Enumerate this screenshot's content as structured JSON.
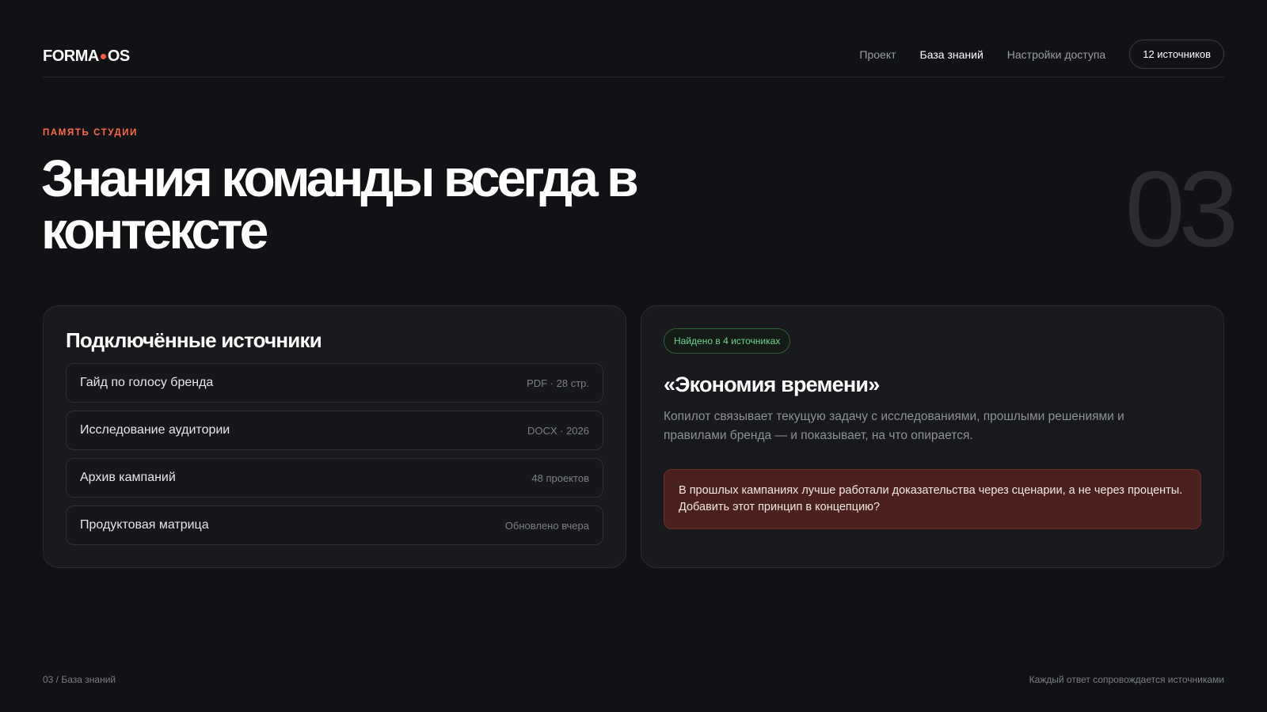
{
  "header": {
    "logo_left": "FORMA",
    "logo_right": "OS",
    "nav": [
      {
        "label": "Проект",
        "active": false
      },
      {
        "label": "База знаний",
        "active": true
      },
      {
        "label": "Настройки доступа",
        "active": false
      }
    ],
    "sources_button": "12 источников"
  },
  "hero": {
    "eyebrow": "ПАМЯТЬ СТУДИИ",
    "title": "Знания команды всегда в контексте",
    "number": "03"
  },
  "sources_card": {
    "title": "Подключённые источники",
    "items": [
      {
        "name": "Гайд по голосу бренда",
        "meta": "PDF · 28 стр."
      },
      {
        "name": "Исследование аудитории",
        "meta": "DOCX · 2026"
      },
      {
        "name": "Архив кампаний",
        "meta": "48 проектов"
      },
      {
        "name": "Продуктовая матрица",
        "meta": "Обновлено вчера"
      }
    ]
  },
  "insight_card": {
    "badge": "Найдено в 4 источниках",
    "title": "«Экономия времени»",
    "description": "Копилот связывает текущую задачу с исследованиями, прошлыми решениями и правилами бренда — и показывает, на что опирается.",
    "suggestion": "В прошлых кампаниях лучше работали доказательства через сценарии, а не через проценты. Добавить этот принцип в концепцию?"
  },
  "footer": {
    "left": "03 / База знаний",
    "right": "Каждый ответ сопровождается источниками"
  },
  "colors": {
    "background": "#111215",
    "accent": "#ff5a3c",
    "success": "#6fd58c",
    "suggestion_bg": "#4a211c"
  }
}
